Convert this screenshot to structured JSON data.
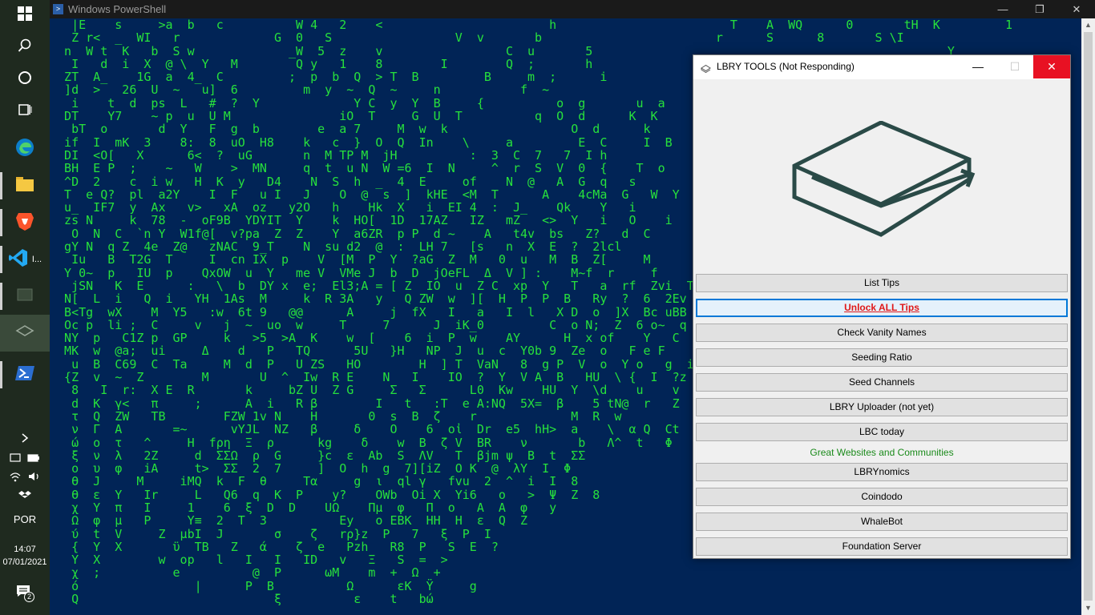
{
  "taskbar": {
    "language": "POR",
    "time": "14:07",
    "date": "07/01/2021",
    "notification_count": "2",
    "vscode_label": "I..."
  },
  "powershell": {
    "title": "Windows PowerShell",
    "matrix_rows": [
      "   |E    s     >a  b   c          W 4   2    <                       h                        T    A  WQ      0       tH  K         1",
      "   Z r<  _  WI   r             G  0   S                 V  v       b                        r      S      8       S \\I        ",
      "  n  W t  K   b  S w             _W  5  z    v                 C  u       5                                                 Y  ",
      "   I   d  i  X  @ \\  Y   M        Q y   1    8        I        Q  ;       h                    ",
      "  ZT  A_    1G  a  4_  C         ;  p  b  Q  > T  B         B     m  ;      i           ",
      "  ]d  >   26  U  ~   u]  6         m  y  ~  Q  ~     n           f  ~                   ",
      "   i    t  d  ps  L   #  ?  Y             Y C  y  Y  B     {          o  g       u  a      ",
      "  DT    Y7    ~ p  u  U M               iO  T     G  U  T          q  O  d      K  K      ",
      "   bT  o       d  Y   F  g  b        e  a 7     M  w  k                 O  d      k       ",
      "  if  I  mK  3    8:  8  uO  H8    k   c  }  O  Q  In    \\     a         E  C     I  B     ",
      "  DI  <O[   X      6<  ?  uG       n  M TP M  jH          :  3  C  7   7  I h            ",
      "  BH  E P  ;    ~   W    >  MN     q  t  u N  W =6  I  N     ^  r  S  V  0  {    T  o     ",
      "  ^D  2    c  i w   H  K  y   D4    N  S  h  _  4  E     of    N  @   A  G  q   s       ",
      "  T  e Q?  pl  a2Y    I  F   u I   J    O  @  s  ]  kHE  <M  T      A    4cMa  G   W  Y    ",
      "  u_  IF7  y  Ax   v>   xA  oz   y2O   h    Hk  X   i  EI 4  :  J_    Qk    Y   i    ",
      "  zs N     k  78  -  oF9B  YDYIT  Y    k  HO[  1D  17AZ   IZ   mZ   <>  Y   i   O    i   ",
      "   O  N  C  `n Y  W1f@[  v?pa  Z  Z    Y  a6ZR  p P  d ~    A   t4v  bs   Z?   d  C   ",
      "  gY N  q Z  4e  Z@   zNAC  9_T    N  su d2  @  :  LH 7   [s   n  X  E  ?  2lcl   ",
      "   Iu   B  T2G  T     I  cn IX  p    V  [M  P  Y  ?aG  Z  M   0  u   M  B  Z[     M   ",
      "  Y 0~  p   IU  p    QxOW  u  Y   me V  VMe J  b  D  jOeFL  Δ  V ] :    M~f  r     f   ",
      "   jSN   K  E      :   \\  b  DY x  e;  El3;A = [ Z  IO  u  Z C  xp  Y   T   a  rf  Zvi  TXB  K  ",
      "  N[  L  i   Q  i   YH  1As  M     k  R 3A   y   Q ZW  w  ][  H  P  P  B   Ry  ?  6  2Ev  ",
      "  B<Tg  wX    M  Y5   :w  6t 9   @@      A     j  fX   I   a   I  l   X D  o  ]X  Bc uBB  0 l7  ",
      "  Oc p  li ;  C     v   j  ~  uo  w     T     7      J  iK_0         C  o N;  Z  6 o~  q  YI   ",
      "  NY  p   C1Z p  GP     k   >5  >A  K    w  [    6  i  P  w    AY      H  x of    Y   C  W  =B k  W   ",
      "  MK  w  @a;  ui     Δ    d   P   TQ      5U   }H   NP  J  u  c  Y0b 9  Ze  o   F e F   ",
      "   u  B  C69  C  Ta     M  d  P   U ZS   HO        H  ] T  VaN   8  g P  V  o  Y o   g  i\\  BKQ  ",
      "  {Z  v  ~  Z        M       U  ^  Iw  R E    N   I    IO  ?  Y  V A  B   HU  \\ {  I  ?z  >  ",
      "   8   I  r:  X E  R       k     bZ U  Z G     Σ   Σ      L0  Kw    HU  Y  \\d    u    v  f  Zgo  S   ",
      "   d  K  γ<   π     ;      A  i   R β        I   t   :T  e A:NQ  5X=  β    5 tN@  r   Z   ",
      "   τ  Q  ZW   TB        FZW 1v N    H       0  s  B  ζ    r             M  R  w  ",
      "   ν  Γ  A       =~      vYJL  NZ   β     δ    O    6  οἰ  Dr  e5  hH>  a    \\  α Q  Ct  ",
      "   ώ  ο  τ   ^     H  fρη  Ξ  ρ      kg    δ    w  B  ζ V  BR    ν       b   Λ^  t   Φ  ",
      "   ξ  ν  λ   2Z     d  ΣΣΩ  ρ  G     }c  ε  Ab  S  ΛV   T  βjm ψ  B  t  ΣΣ   ",
      "   ο  υ  φ   iA     t>  ΣΣ  2  7     ]  O  h  g  7][iZ  O K  @  λY  I  Φ   ",
      "   ϴ  J     M     iMQ  k  F  θ     Τα     g  ι  ql γ   fvu  2  ^  i  I  8   ",
      "   ϴ  ε  Υ   Ir     L   Q6  q  K  P    y?    OWb  Oi X  Yi6   ο   >  Ψ  Z  8   ",
      "   χ  Υ  π   I     1    6  ξ  D  D    UΩ    Πμ  φ   Π  ο   A  Α  φ   y   ",
      "   Ω  φ  μ   P     Y≡  2  T  3          Ey   o EBK  HH  H  ε  Q  Ζ   ",
      "   ύ  t  V     Z  μbI  J       σ    ζ   rρ}z  P   7   ξ  P  Ι   ",
      "   {  Υ  Χ       ϋ  TB   Z   ά    ζ  e   Pzh   R8  P   S  E  ?   ",
      "   Υ  Χ        w  op   l   I   I   ID   v   Ξ   S  =  >   ",
      "   χ  ;          e          @  Ρ      ωM    m  +  Ω  +   ",
      "   ό                |      P  B          Ω      εK  Ÿ     g  ",
      "   Q                           ξ          ε    t   bώ  "
    ]
  },
  "lbry": {
    "title": "LBRY TOOLS (Not Responding)",
    "buttons": {
      "list_tips": "List Tips",
      "unlock_all_tips": "Unlock ALL Tips",
      "check_vanity_names": "Check Vanity Names",
      "seeding_ratio": "Seeding Ratio",
      "seed_channels": "Seed Channels",
      "lbry_uploader": "LBRY Uploader (not yet)",
      "lbc_today": "LBC today",
      "lbrynomics": "LBRYnomics",
      "coindodo": "Coindodo",
      "whalebot": "WhaleBot",
      "foundation_server": "Foundation Server"
    },
    "section_label": "Great Websites and Communities"
  },
  "colors": {
    "ps_bg": "#012456",
    "matrix_green": "#27e03c",
    "logo_stroke": "#2a4a47",
    "close_red": "#e81123",
    "highlight_red": "#e01818",
    "label_green": "#1a8a1a"
  }
}
